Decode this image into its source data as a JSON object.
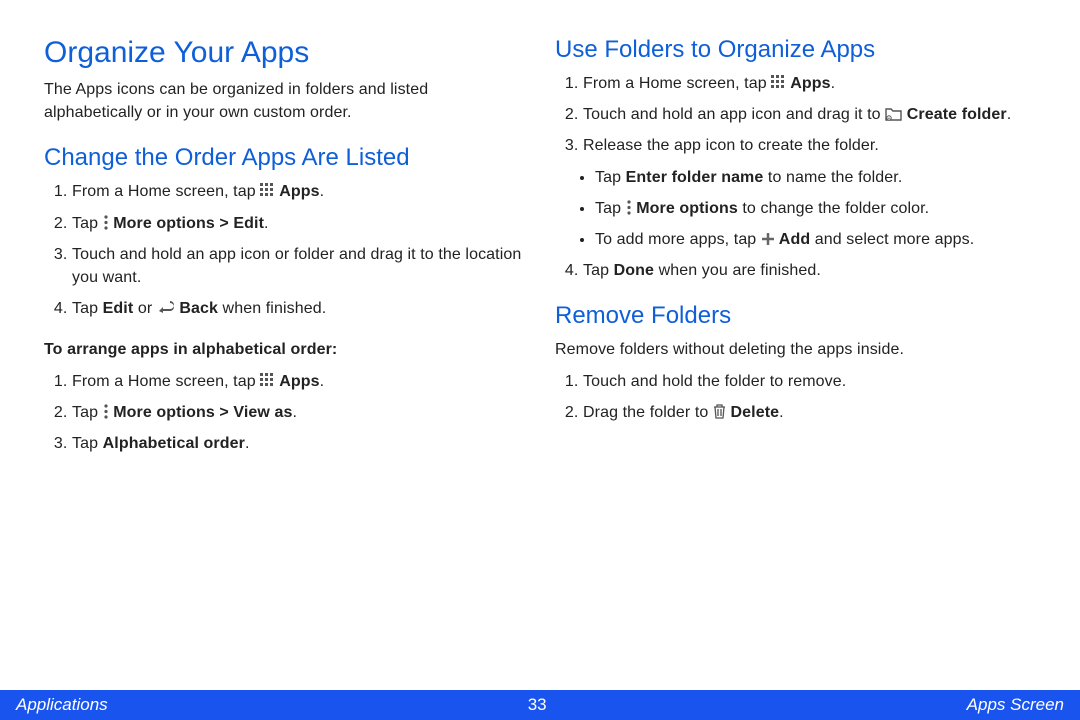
{
  "leftCol": {
    "title": "Organize Your Apps",
    "intro": "The Apps icons can be organized in folders and listed alphabetically or in your own custom order.",
    "section1": {
      "heading": "Change the Order Apps Are Listed",
      "step1_pre": "From a Home screen, tap ",
      "step1_post": " Apps",
      "step2_pre": "Tap ",
      "step2_mid": " More options > Edit",
      "step3": "Touch and hold an app icon or folder and drag it to the location you want.",
      "step4_pre": "Tap ",
      "step4_b1": "Edit",
      "step4_mid": " or ",
      "step4_b2": " Back",
      "step4_post": " when finished.",
      "subheading": "To arrange apps in alphabetical order:",
      "sub_step1_pre": "From a Home screen, tap ",
      "sub_step1_post": " Apps",
      "sub_step2_pre": "Tap ",
      "sub_step2_b": " More options > View as",
      "sub_step3_pre": "Tap ",
      "sub_step3_b": "Alphabetical order"
    }
  },
  "rightCol": {
    "section2": {
      "heading": "Use Folders to Organize Apps",
      "step1_pre": "From a Home screen, tap ",
      "step1_post": " Apps",
      "step2_pre": "Touch and hold an app icon and drag it to ",
      "step2_b": " Create folder",
      "step3": "Release the app icon to create the folder.",
      "bullet1_pre": "Tap ",
      "bullet1_b": "Enter folder name",
      "bullet1_post": " to name the folder.",
      "bullet2_pre": "Tap ",
      "bullet2_b": " More options",
      "bullet2_post": " to change the folder color.",
      "bullet3_pre": "To add more apps, tap ",
      "bullet3_b": " Add",
      "bullet3_post": " and select more apps.",
      "step4_pre": "Tap ",
      "step4_b": "Done",
      "step4_post": " when you are finished."
    },
    "section3": {
      "heading": "Remove Folders",
      "intro": "Remove folders without deleting the apps inside.",
      "step1": "Touch and hold the folder to remove.",
      "step2_pre": "Drag the folder to ",
      "step2_b": " Delete"
    }
  },
  "footer": {
    "left": "Applications",
    "page": "33",
    "right": "Apps Screen"
  }
}
